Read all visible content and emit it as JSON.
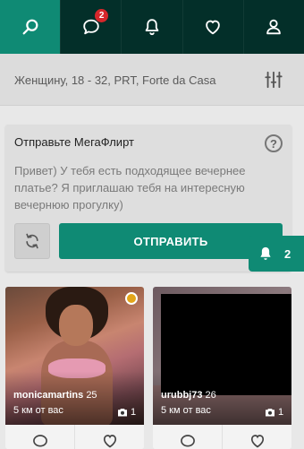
{
  "nav": {
    "items": [
      {
        "icon": "search-icon",
        "active": true
      },
      {
        "icon": "chat-icon",
        "badge": "2"
      },
      {
        "icon": "bell-icon"
      },
      {
        "icon": "heart-icon"
      },
      {
        "icon": "user-icon"
      }
    ],
    "chat_badge": "2"
  },
  "filter": {
    "text": "Женщину, 18 - 32, PRT, Forte da Casa",
    "icon": "sliders-icon"
  },
  "megaflirt": {
    "title": "Отправьте МегаФлирт",
    "help_icon": "?",
    "message": "Привет) У тебя есть подходящее вечернее платье? Я приглашаю тебя на интересную вечернюю прогулку)",
    "refresh_icon": "refresh-icon",
    "send_label": "ОТПРАВИТЬ"
  },
  "notification_tab": {
    "icon": "bell-icon",
    "count": "2"
  },
  "profiles": [
    {
      "username": "monicamartins",
      "age": "25",
      "distance": "5 км от вас",
      "photos": "1",
      "online": true
    },
    {
      "username": "urubbj73",
      "age": "26",
      "distance": "5 км от вас",
      "photos": "1",
      "online": false
    }
  ],
  "colors": {
    "nav_bg": "#05483e",
    "accent": "#0f8a74",
    "badge": "#d6272b",
    "online": "#e3a51a"
  }
}
